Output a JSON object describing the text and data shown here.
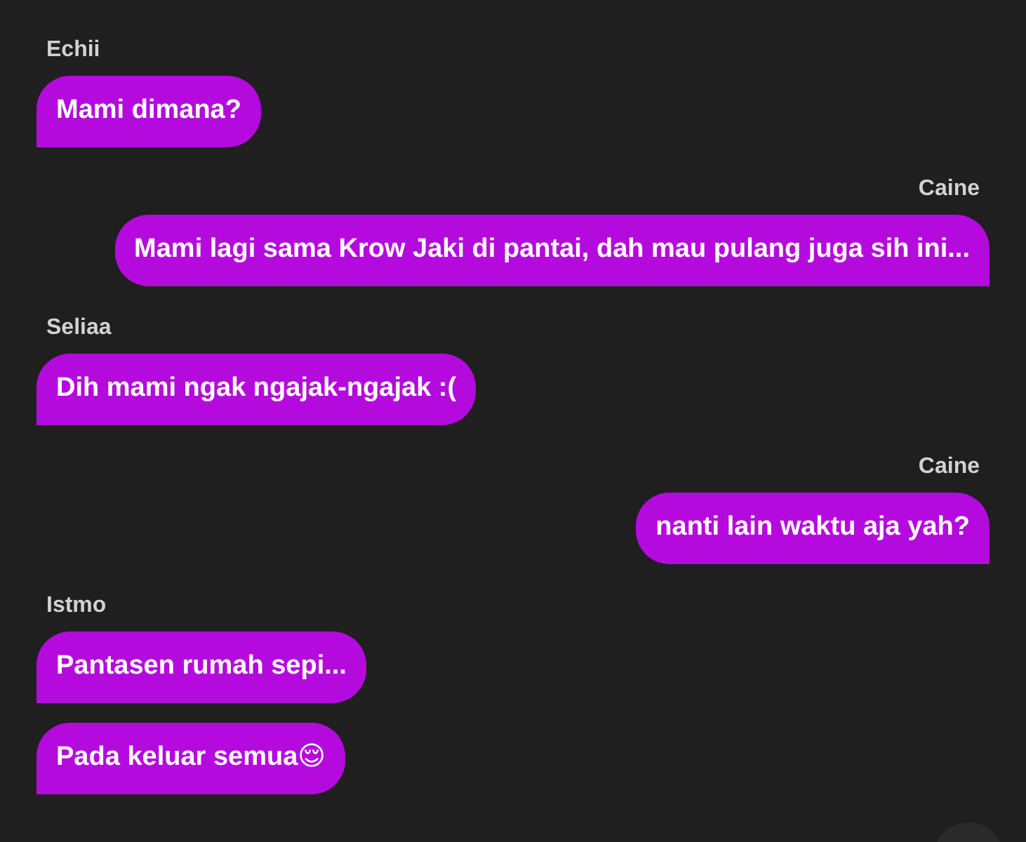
{
  "messages": [
    {
      "sender": "Echii",
      "kind": "incoming",
      "bubbles": [
        "Mami dimana?"
      ]
    },
    {
      "sender": "Caine",
      "kind": "outgoing",
      "bubbles": [
        "Mami lagi sama Krow Jaki di pantai, dah mau pulang juga sih ini..."
      ]
    },
    {
      "sender": "Seliaa",
      "kind": "incoming",
      "bubbles": [
        "Dih mami ngak ngajak-ngajak :("
      ]
    },
    {
      "sender": "Caine",
      "kind": "outgoing",
      "bubbles": [
        "nanti lain waktu aja yah?"
      ]
    },
    {
      "sender": "Istmo",
      "kind": "incoming",
      "bubbles": [
        "Pantasen rumah sepi...",
        "Pada keluar semua😌"
      ]
    }
  ]
}
